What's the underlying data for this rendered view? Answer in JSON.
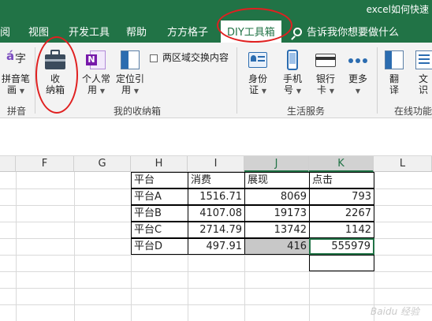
{
  "window": {
    "title": "excel如何快速"
  },
  "tabs": [
    {
      "label": "阅"
    },
    {
      "label": "视图"
    },
    {
      "label": "开发工具"
    },
    {
      "label": "帮助"
    },
    {
      "label": "方方格子"
    },
    {
      "label": "DIY工具箱",
      "active": true
    }
  ],
  "tell_me": {
    "label": "告诉我你想要做什么"
  },
  "ribbon": {
    "pinyin": {
      "label1": "拼音笔",
      "label2": "画",
      "group": "拼音"
    },
    "toolbox": {
      "label1": "收",
      "label2": "纳箱"
    },
    "personal": {
      "label1": "个人常",
      "label2": "用"
    },
    "locate": {
      "label1": "定位引",
      "label2": "用"
    },
    "swap_checkbox": {
      "label": "两区域交换内容"
    },
    "group_mybox": "我的收纳箱",
    "idcard": {
      "label1": "身份",
      "label2": "证"
    },
    "phone": {
      "label1": "手机",
      "label2": "号"
    },
    "bank": {
      "label1": "银行",
      "label2": "卡"
    },
    "more": {
      "label1": "更多"
    },
    "group_life": "生活服务",
    "translate": {
      "label1": "翻",
      "label2": "译"
    },
    "text": {
      "label1": "文",
      "label2": "识"
    },
    "group_online": "在线功能"
  },
  "columns": [
    "F",
    "G",
    "H",
    "I",
    "J",
    "K",
    "L"
  ],
  "table": {
    "headers": [
      "平台",
      "消费",
      "展现",
      "点击"
    ],
    "rows": [
      {
        "platform": "平台A",
        "spend": "1516.71",
        "impressions": "8069",
        "clicks": "793"
      },
      {
        "platform": "平台B",
        "spend": "4107.08",
        "impressions": "19173",
        "clicks": "2267"
      },
      {
        "platform": "平台C",
        "spend": "2714.79",
        "impressions": "13742",
        "clicks": "1142"
      },
      {
        "platform": "平台D",
        "spend": "497.91",
        "impressions": "416",
        "clicks": "555979"
      }
    ]
  },
  "watermark": "Baidu 经验",
  "colors": {
    "accent": "#217346",
    "highlight": "#e02020",
    "selected_fill": "#c8c8c8"
  }
}
